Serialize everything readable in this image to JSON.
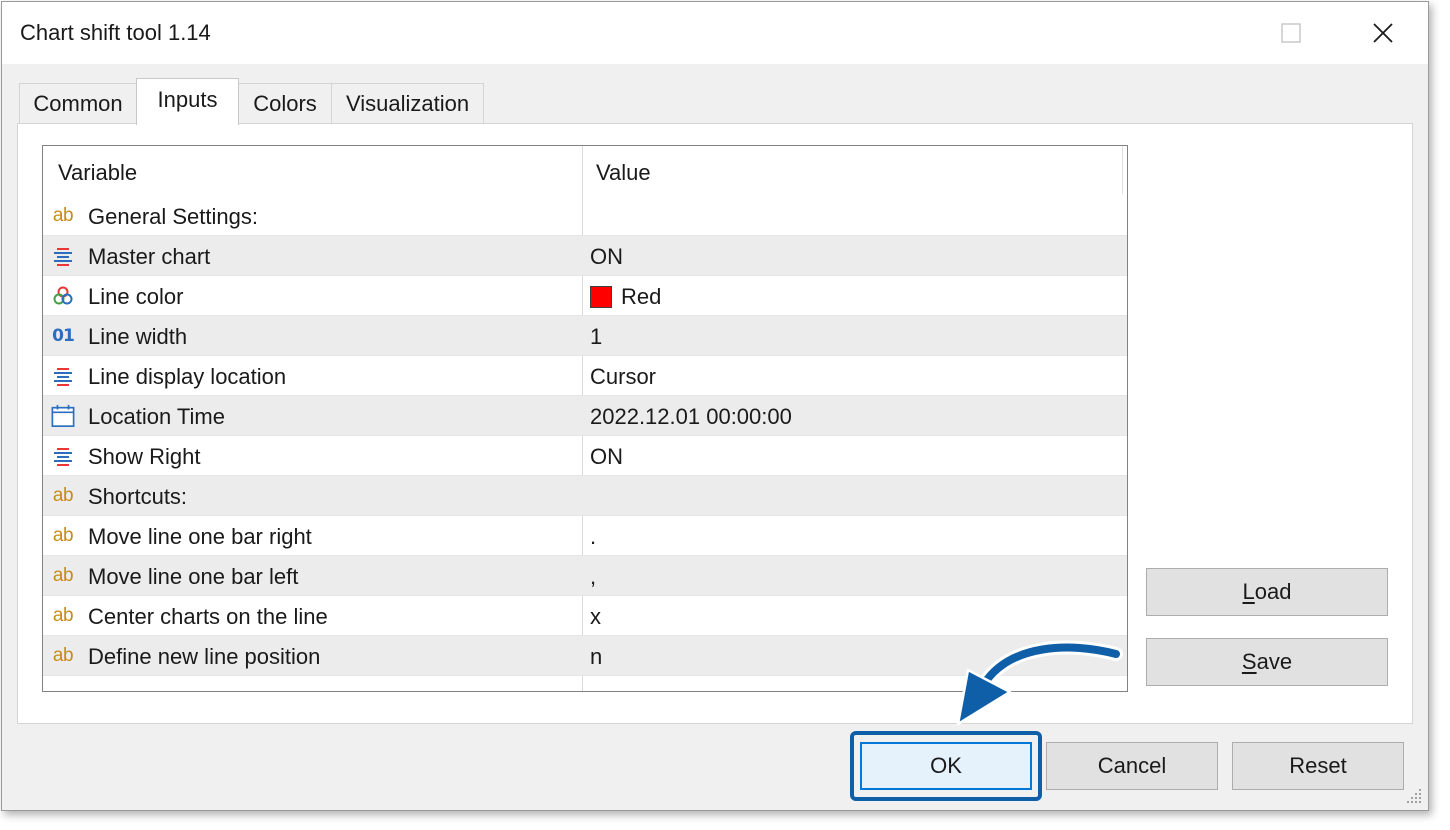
{
  "window": {
    "title": "Chart shift tool 1.14"
  },
  "tabs": [
    {
      "label": "Common",
      "active": false
    },
    {
      "label": "Inputs",
      "active": true
    },
    {
      "label": "Colors",
      "active": false
    },
    {
      "label": "Visualization",
      "active": false
    }
  ],
  "grid": {
    "headers": {
      "variable": "Variable",
      "value": "Value"
    },
    "rows": [
      {
        "icon": "ab-string-icon",
        "name": "General Settings:",
        "value": ""
      },
      {
        "icon": "enum-list-icon",
        "name": "Master chart",
        "value": "ON"
      },
      {
        "icon": "color-icon",
        "name": "Line color",
        "value": "Red",
        "color": "#ff0000"
      },
      {
        "icon": "integer-icon",
        "name": "Line width",
        "value": "1"
      },
      {
        "icon": "enum-list-icon",
        "name": "Line display location",
        "value": "Cursor"
      },
      {
        "icon": "calendar-icon",
        "name": "Location Time",
        "value": "2022.12.01 00:00:00"
      },
      {
        "icon": "enum-list-icon",
        "name": "Show Right",
        "value": "ON"
      },
      {
        "icon": "ab-string-icon",
        "name": "Shortcuts:",
        "value": ""
      },
      {
        "icon": "ab-string-icon",
        "name": "Move line one bar right",
        "value": "."
      },
      {
        "icon": "ab-string-icon",
        "name": "Move line one bar left",
        "value": ","
      },
      {
        "icon": "ab-string-icon",
        "name": "Center charts on the line",
        "value": "x"
      },
      {
        "icon": "ab-string-icon",
        "name": "Define new line position",
        "value": "n"
      }
    ]
  },
  "side_buttons": {
    "load": {
      "accel": "L",
      "rest": "oad"
    },
    "save": {
      "accel": "S",
      "rest": "ave"
    }
  },
  "footer_buttons": {
    "ok": "OK",
    "cancel": "Cancel",
    "reset": "Reset"
  },
  "ab_glyph": "ab",
  "int_glyph": "01",
  "colors": {
    "accent": "#0078d7",
    "highlight": "#0f5fa8",
    "string_icon": "#c98a1a"
  }
}
